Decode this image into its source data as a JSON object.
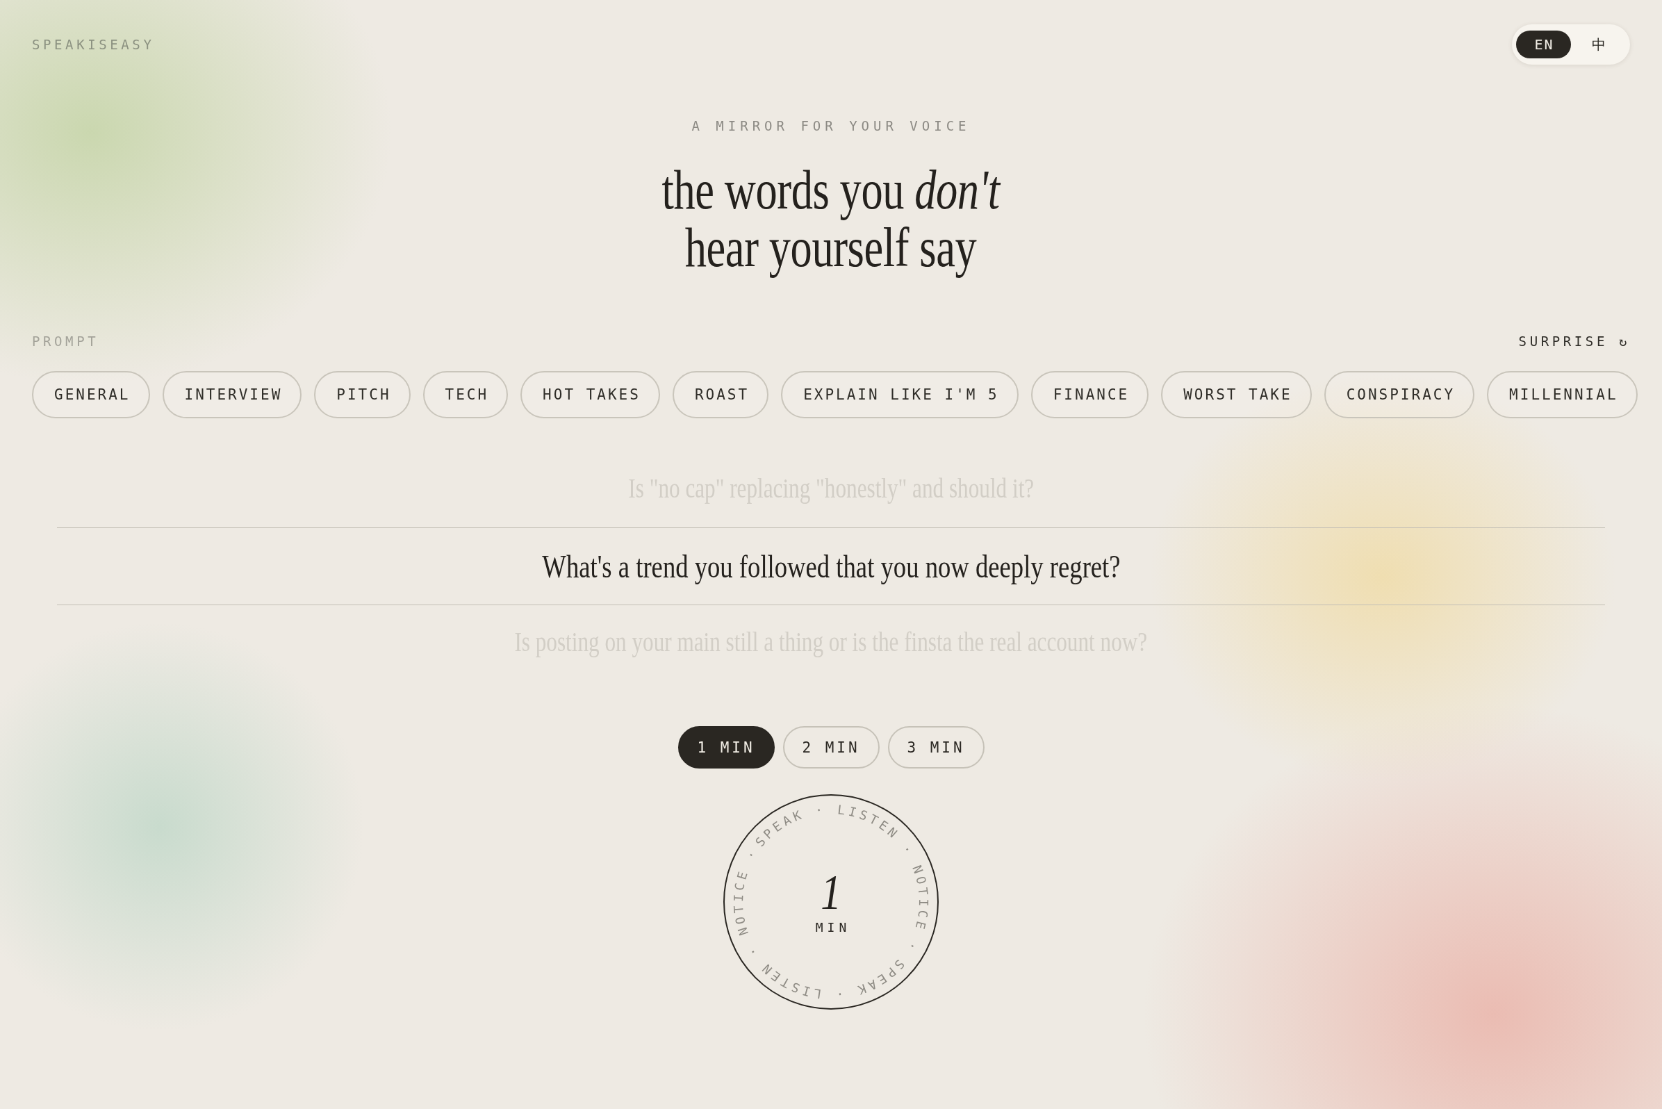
{
  "header": {
    "logo": "SPEAKISEASY",
    "languages": [
      {
        "label": "EN",
        "selected": true
      },
      {
        "label": "中",
        "selected": false
      }
    ]
  },
  "hero": {
    "tagline": "A MIRROR FOR YOUR VOICE",
    "headline_lines": [
      "the words you *don't*",
      "hear yourself say"
    ]
  },
  "prompt": {
    "label": "PROMPT",
    "surprise_button": "SURPRISE ↻",
    "categories": [
      {
        "label": "GENERAL",
        "selected": false
      },
      {
        "label": "INTERVIEW",
        "selected": false
      },
      {
        "label": "PITCH",
        "selected": false
      },
      {
        "label": "TECH",
        "selected": false
      },
      {
        "label": "HOT TAKES",
        "selected": false
      },
      {
        "label": "ROAST",
        "selected": false
      },
      {
        "label": "EXPLAIN LIKE I'M 5",
        "selected": false
      },
      {
        "label": "FINANCE",
        "selected": false
      },
      {
        "label": "WORST TAKE",
        "selected": false
      },
      {
        "label": "CONSPIRACY",
        "selected": false
      },
      {
        "label": "MILLENNIAL",
        "selected": false
      }
    ]
  },
  "questions": [
    {
      "text": "Is \"no cap\" replacing \"honestly\" and should it?",
      "selected": false
    },
    {
      "text": "What's a trend you followed that you now deeply regret?",
      "selected": true
    },
    {
      "text": "Is posting on your main still a thing or is the finsta the real account now?",
      "selected": false
    }
  ],
  "durations": [
    {
      "label": "1 MIN",
      "selected": true
    },
    {
      "label": "2 MIN",
      "selected": false
    },
    {
      "label": "3 MIN",
      "selected": false
    }
  ],
  "timer": {
    "value": "1",
    "unit": "MIN",
    "ring_text": "SPEAK · LISTEN · NOTICE · SPEAK · LISTEN · NOTICE ·"
  }
}
